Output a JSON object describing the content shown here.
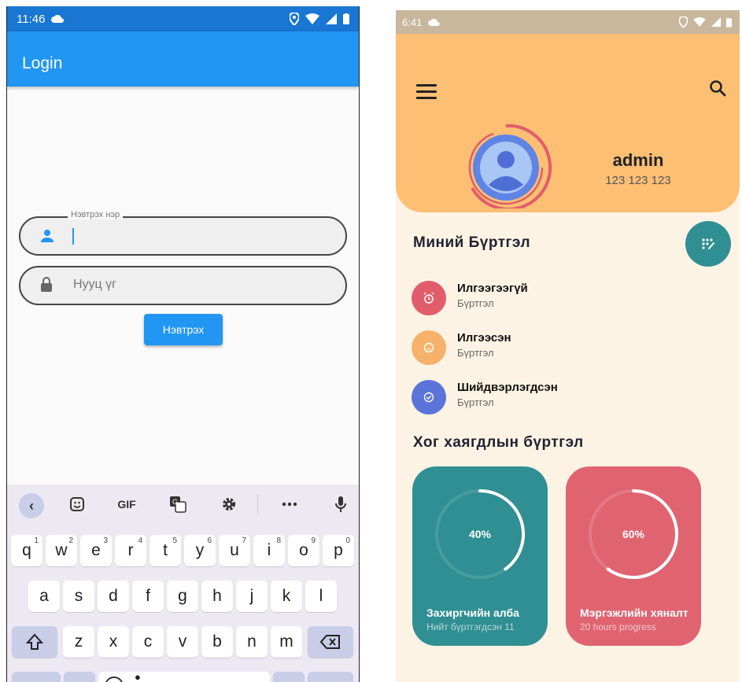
{
  "left": {
    "status_time": "11:46",
    "appbar_title": "Login",
    "username_label": "Нэвтрэх нэр",
    "username_value": "",
    "password_placeholder": "Нууц үг",
    "login_button": "Нэвтрэх",
    "keyboard": {
      "gif_label": "GIF",
      "row1": [
        {
          "k": "q",
          "n": "1"
        },
        {
          "k": "w",
          "n": "2"
        },
        {
          "k": "e",
          "n": "3"
        },
        {
          "k": "r",
          "n": "4"
        },
        {
          "k": "t",
          "n": "5"
        },
        {
          "k": "y",
          "n": "6"
        },
        {
          "k": "u",
          "n": "7"
        },
        {
          "k": "i",
          "n": "8"
        },
        {
          "k": "o",
          "n": "9"
        },
        {
          "k": "p",
          "n": "0"
        }
      ],
      "row2": [
        "a",
        "s",
        "d",
        "f",
        "g",
        "h",
        "j",
        "k",
        "l"
      ],
      "row3": [
        "z",
        "x",
        "c",
        "v",
        "b",
        "n",
        "m"
      ]
    }
  },
  "right": {
    "status_time": "6:41",
    "user_name": "admin",
    "user_phone": "123 123 123",
    "section_my_registration": "Миний Бүртгэл",
    "registrations": [
      {
        "title": "Илгээгээгүй",
        "subtitle": "Бүртгэл",
        "color": "#e25d6b",
        "icon": "alarm-icon"
      },
      {
        "title": "Илгээсэн",
        "subtitle": "Бүртгэл",
        "color": "#f6b26b",
        "icon": "smile-icon"
      },
      {
        "title": "Шийдвэрлэгдсэн",
        "subtitle": "Бүртгэл",
        "color": "#5a74d9",
        "icon": "check-circle-icon"
      }
    ],
    "section_waste": "Хог хаягдлын бүртгэл",
    "cards": [
      {
        "percent_label": "40%",
        "progress": 0.4,
        "title": "Захиргчийн алба",
        "subtitle": "Нийт бүртгэгдсэн 11",
        "color": "#2f8f93"
      },
      {
        "percent_label": "60%",
        "progress": 0.6,
        "title": "Мэргэжлийн хяналт",
        "subtitle": "20 hours progress",
        "color": "#e06470"
      }
    ],
    "colors": {
      "header": "#fcbf74",
      "background": "#fdf3e4",
      "teal": "#2f8f93",
      "red": "#e06470"
    }
  }
}
